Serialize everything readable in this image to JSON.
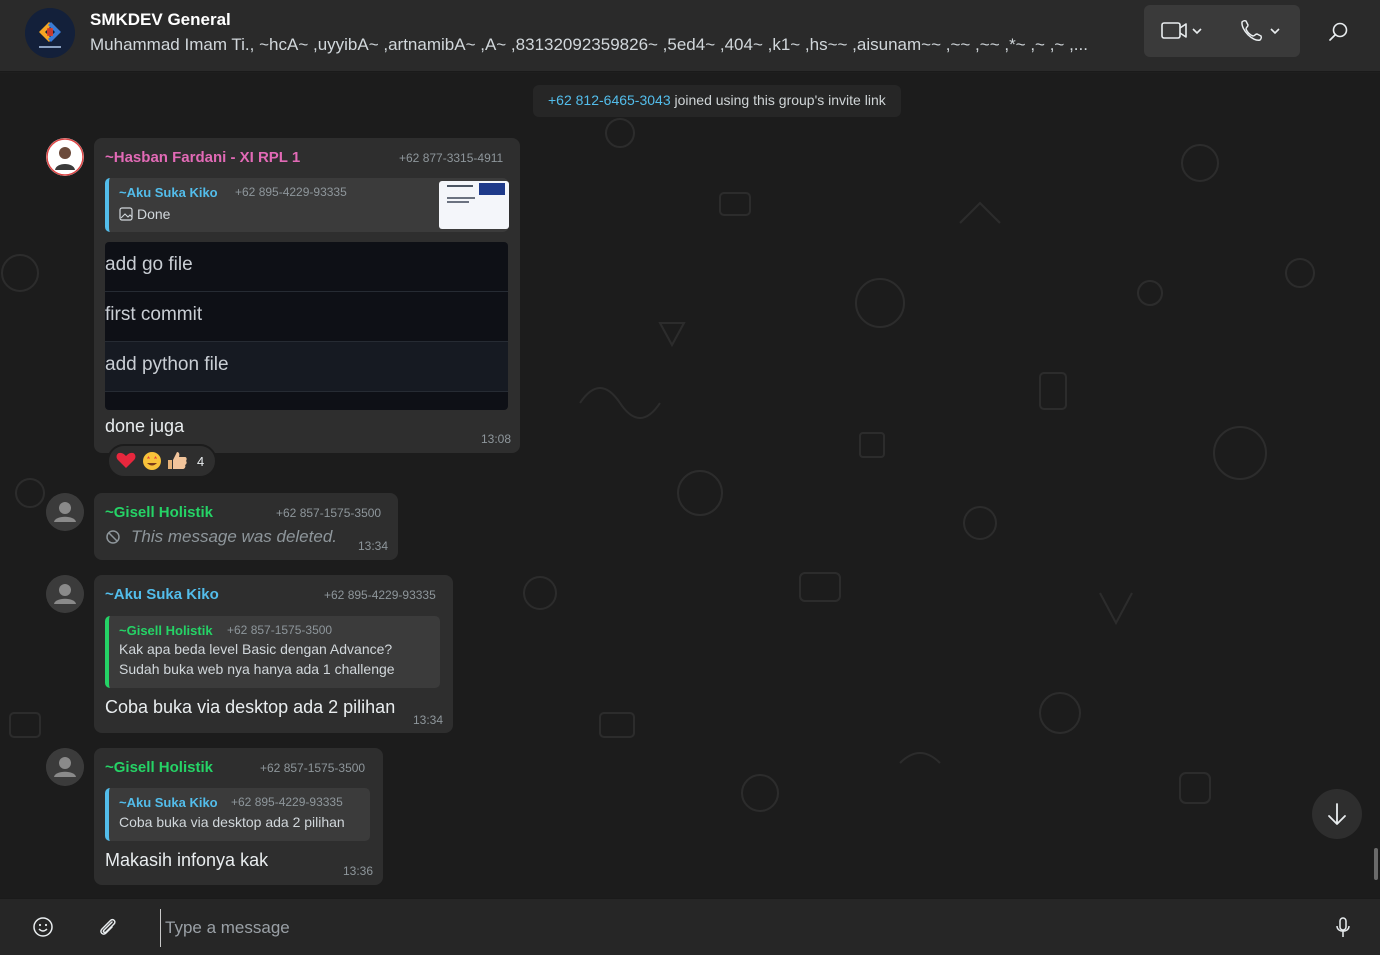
{
  "header": {
    "title": "SMKDEV General",
    "members": "Muhammad Imam Ti., ~hcA~ ,uyyibA~ ,artnamibA~ ,A~ ,83132092359826~ ,5ed4~ ,404~ ,k1~ ,hs~~ ,aisunam~~ ,~~ ,~~ ,*~ ,~ ,~ ,..."
  },
  "system": {
    "phone": "+62 812-6465-3043",
    "text": " joined using this group's invite link"
  },
  "messages": [
    {
      "sender": "~Hasban Fardani - XI RPL 1",
      "sender_color": "#e26ab6",
      "phone": "+62 877-3315-4911",
      "quote": {
        "name": "~Aku Suka Kiko",
        "phone": "+62 895-4229-93335",
        "text": "Done"
      },
      "image_rows": [
        "add go file",
        "first commit",
        "add python file"
      ],
      "text": "done juga",
      "time": "13:08",
      "reactions": {
        "count": "4"
      }
    },
    {
      "sender": "~Gisell Holistik",
      "sender_color": "#25d366",
      "phone": "+62 857-1575-3500",
      "text": "This message was deleted.",
      "time": "13:34"
    },
    {
      "sender": "~Aku Suka Kiko",
      "sender_color": "#53bdeb",
      "phone": "+62 895-4229-93335",
      "quote": {
        "name": "~Gisell Holistik",
        "phone": "+62 857-1575-3500",
        "line1": "Kak apa beda level Basic dengan Advance?",
        "line2": "Sudah buka web nya hanya ada 1 challenge"
      },
      "text": "Coba buka via desktop ada 2 pilihan",
      "time": "13:34"
    },
    {
      "sender": "~Gisell Holistik",
      "sender_color": "#25d366",
      "phone": "+62 857-1575-3500",
      "quote": {
        "name": "~Aku Suka Kiko",
        "phone": "+62 895-4229-93335",
        "text": "Coba buka via desktop ada 2 pilihan"
      },
      "text": "Makasih infonya kak",
      "time": "13:36"
    }
  ],
  "composer": {
    "placeholder": "Type a message"
  },
  "icons": {
    "video": "video-call-icon",
    "phone": "voice-call-icon",
    "search": "search-icon",
    "emoji": "emoji-icon",
    "attach": "paperclip-icon",
    "mic": "microphone-icon",
    "scroll": "arrow-down-icon"
  },
  "colors": {
    "accent_blue": "#53bdeb",
    "accent_green": "#25d366",
    "accent_pink": "#e26ab6"
  }
}
